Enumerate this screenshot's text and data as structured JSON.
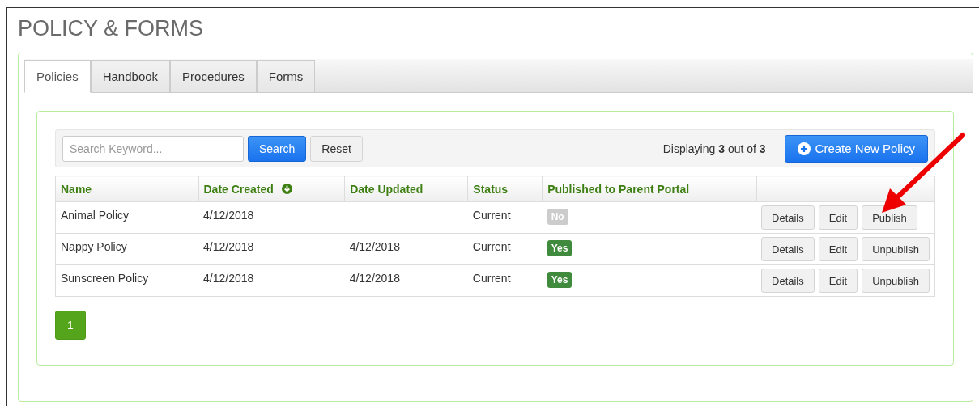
{
  "page": {
    "title": "POLICY & FORMS"
  },
  "tabs": [
    {
      "label": "Policies",
      "selected": true
    },
    {
      "label": "Handbook",
      "selected": false
    },
    {
      "label": "Procedures",
      "selected": false
    },
    {
      "label": "Forms",
      "selected": false
    }
  ],
  "toolbar": {
    "search": {
      "placeholder": "Search Keyword..."
    },
    "search_button": "Search",
    "reset_button": "Reset",
    "count": "Displaying **3** out of **3**",
    "create_button": "Create New Policy"
  },
  "table": {
    "columns": [
      {
        "label": "Name",
        "sorted": false
      },
      {
        "label": "Date Created",
        "sorted": true
      },
      {
        "label": "Date Updated",
        "sorted": false
      },
      {
        "label": "Status",
        "sorted": false
      },
      {
        "label": "Published to Parent Portal",
        "sorted": false
      },
      {
        "sorted": false
      }
    ],
    "rows": [
      {
        "name": "Animal Policy",
        "date_created": "4/12/2018",
        "status": "Current",
        "published": false,
        "badge": "No",
        "actions": [
          "Details",
          "Edit",
          "Publish"
        ]
      },
      {
        "name": "Nappy Policy",
        "date_created": "4/12/2018",
        "date_updated": "4/12/2018",
        "status": "Current",
        "published": true,
        "badge": "Yes",
        "actions": [
          "Details",
          "Edit",
          "Unpublish"
        ]
      },
      {
        "name": "Sunscreen Policy",
        "date_created": "4/12/2018",
        "date_updated": "4/12/2018",
        "status": "Current",
        "published": true,
        "badge": "Yes",
        "actions": [
          "Details",
          "Edit",
          "Unpublish"
        ]
      }
    ]
  },
  "pagination": [
    {
      "label": "1",
      "selected": true
    }
  ]
}
